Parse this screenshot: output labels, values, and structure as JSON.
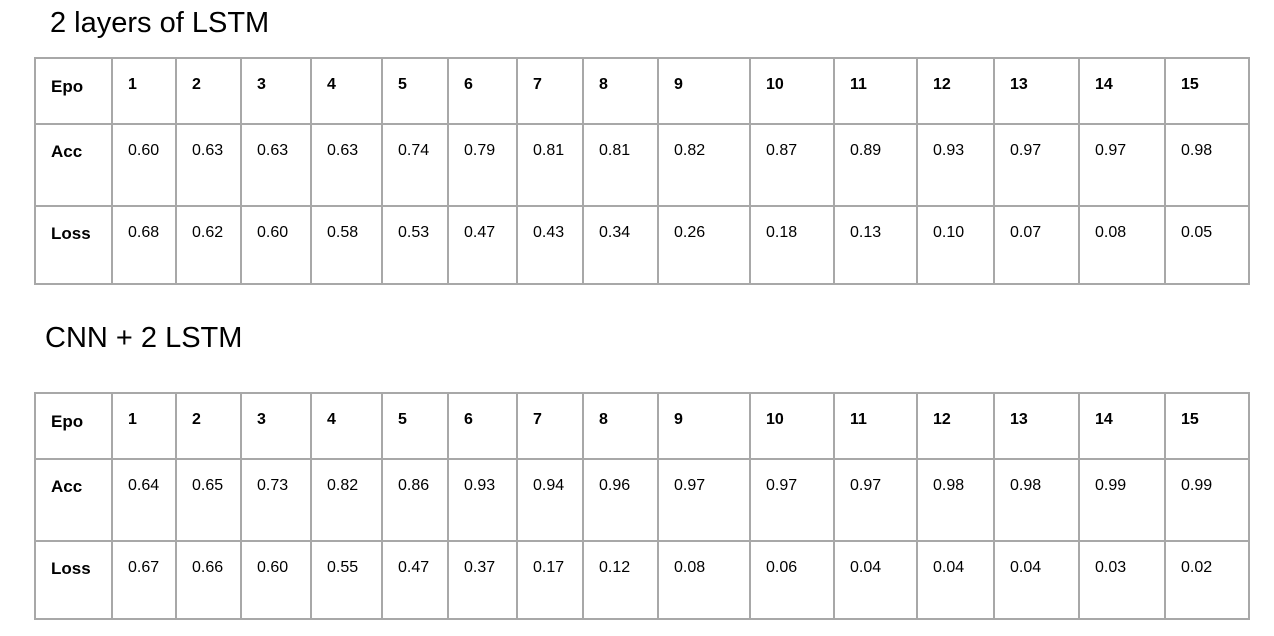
{
  "tables": [
    {
      "title": "2 layers of LSTM",
      "rows": [
        {
          "label": "Epo",
          "cells": [
            "1",
            "2",
            "3",
            "4",
            "5",
            "6",
            "7",
            "8",
            "9",
            "10",
            "11",
            "12",
            "13",
            "14",
            "15"
          ]
        },
        {
          "label": "Acc",
          "cells": [
            "0.60",
            "0.63",
            "0.63",
            "0.63",
            "0.74",
            "0.79",
            "0.81",
            "0.81",
            "0.82",
            "0.87",
            "0.89",
            "0.93",
            "0.97",
            "0.97",
            "0.98"
          ]
        },
        {
          "label": "Loss",
          "cells": [
            "0.68",
            "0.62",
            "0.60",
            "0.58",
            "0.53",
            "0.47",
            "0.43",
            "0.34",
            "0.26",
            "0.18",
            "0.13",
            "0.10",
            "0.07",
            "0.08",
            "0.05"
          ]
        }
      ]
    },
    {
      "title": "CNN + 2 LSTM",
      "rows": [
        {
          "label": "Epo",
          "cells": [
            "1",
            "2",
            "3",
            "4",
            "5",
            "6",
            "7",
            "8",
            "9",
            "10",
            "11",
            "12",
            "13",
            "14",
            "15"
          ]
        },
        {
          "label": "Acc",
          "cells": [
            "0.64",
            "0.65",
            "0.73",
            "0.82",
            "0.86",
            "0.93",
            "0.94",
            "0.96",
            "0.97",
            "0.97",
            "0.97",
            "0.98",
            "0.98",
            "0.99",
            "0.99"
          ]
        },
        {
          "label": "Loss",
          "cells": [
            "0.67",
            "0.66",
            "0.60",
            "0.55",
            "0.47",
            "0.37",
            "0.17",
            "0.12",
            "0.08",
            "0.06",
            "0.04",
            "0.04",
            "0.04",
            "0.03",
            "0.02"
          ]
        }
      ]
    }
  ]
}
